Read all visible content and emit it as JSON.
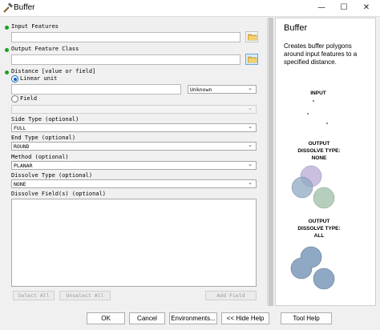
{
  "window": {
    "title": "Buffer",
    "minimize_glyph": "—",
    "maximize_glyph": "☐",
    "close_glyph": "✕"
  },
  "form": {
    "input_features": {
      "label": "Input Features",
      "value": ""
    },
    "output_feature_class": {
      "label": "Output Feature Class",
      "value": ""
    },
    "distance": {
      "label": "Distance [value or field]",
      "linear_unit_label": "Linear unit",
      "linear_value": "",
      "unit_value": "Unknown",
      "field_label": "Field",
      "field_value": ""
    },
    "side_type": {
      "label": "Side Type (optional)",
      "value": "FULL"
    },
    "end_type": {
      "label": "End Type (optional)",
      "value": "ROUND"
    },
    "method": {
      "label": "Method (optional)",
      "value": "PLANAR"
    },
    "dissolve_type": {
      "label": "Dissolve Type (optional)",
      "value": "NONE"
    },
    "dissolve_fields": {
      "label": "Dissolve Field(s) (optional)"
    },
    "select_all": "Select All",
    "unselect_all": "Unselect All",
    "add_field": "Add Field"
  },
  "help": {
    "title": "Buffer",
    "description": "Creates buffer polygons around input features to a specified distance.",
    "input_caption": "INPUT",
    "output_none_caption_1": "OUTPUT",
    "output_none_caption_2": "DISSOLVE TYPE:",
    "output_none_caption_3": "NONE",
    "output_all_caption_1": "OUTPUT",
    "output_all_caption_2": "DISSOLVE TYPE:",
    "output_all_caption_3": "ALL"
  },
  "footer": {
    "ok": "OK",
    "cancel": "Cancel",
    "environments": "Environments...",
    "hide_help": "<< Hide Help",
    "tool_help": "Tool Help"
  },
  "colors": {
    "required_dot": "#1aa21a",
    "radio_accent": "#1565c0",
    "buffer_purple": "#b9a9d6",
    "buffer_blue": "#8fa9c4",
    "buffer_green": "#9ebfa6"
  }
}
